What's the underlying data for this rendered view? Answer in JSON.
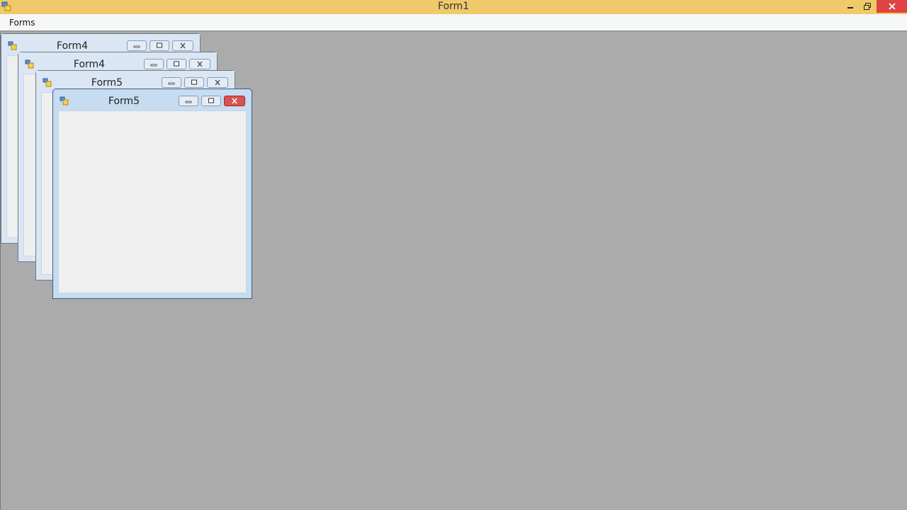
{
  "window": {
    "title": "Form1",
    "icon": "app-form-icon"
  },
  "menu": {
    "items": [
      {
        "label": "Forms"
      }
    ]
  },
  "mdi_children": [
    {
      "title": "Form4",
      "icon": "app-form-icon",
      "state": "inactive"
    },
    {
      "title": "Form4",
      "icon": "app-form-icon",
      "state": "inactive"
    },
    {
      "title": "Form5",
      "icon": "app-form-icon",
      "state": "inactive"
    },
    {
      "title": "Form5",
      "icon": "app-form-icon",
      "state": "active"
    }
  ],
  "colors": {
    "titlebar": "#f0c96a",
    "mdi_background": "#ababab",
    "close_button": "#e04343"
  }
}
